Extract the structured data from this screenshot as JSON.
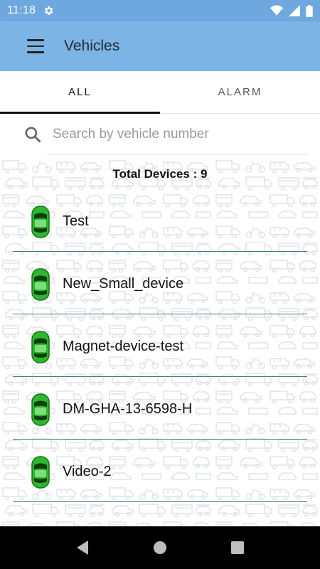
{
  "status_bar": {
    "time": "11:18",
    "icons": [
      "settings-icon",
      "wifi-icon",
      "signal-icon",
      "battery-icon"
    ]
  },
  "app_bar": {
    "title": "Vehicles",
    "menu_icon": "hamburger-menu-icon",
    "color": "#7cb4e6"
  },
  "tabs": [
    {
      "label": "ALL",
      "active": true
    },
    {
      "label": "ALARM",
      "active": false
    }
  ],
  "search": {
    "placeholder": "Search by vehicle number",
    "value": ""
  },
  "total_label": "Total Devices : 9",
  "vehicles": [
    {
      "name": "Test",
      "status_color": "#2fb52f"
    },
    {
      "name": "New_Small_device",
      "status_color": "#2fb52f"
    },
    {
      "name": "Magnet-device-test",
      "status_color": "#2fb52f"
    },
    {
      "name": "DM-GHA-13-6598-H",
      "status_color": "#2fb52f"
    },
    {
      "name": "Video-2",
      "status_color": "#2fb52f"
    }
  ],
  "nav": [
    "back-icon",
    "home-icon",
    "recents-icon"
  ]
}
